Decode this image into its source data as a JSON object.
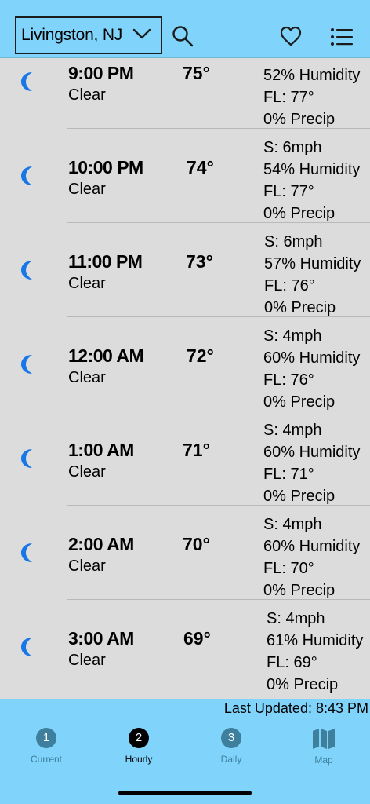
{
  "header": {
    "location": "Livingston, NJ",
    "icons": [
      "chevron-down-icon",
      "search-icon",
      "heart-icon",
      "list-icon"
    ]
  },
  "hourly": [
    {
      "time": "9:00 PM",
      "condition": "Clear",
      "temp": "75°",
      "wind": "",
      "humidity": "52% Humidity",
      "feels_like": "FL: 77°",
      "precip": "0% Precip",
      "icon": "moon-icon"
    },
    {
      "time": "10:00 PM",
      "condition": "Clear",
      "temp": "74°",
      "wind": "S: 6mph",
      "humidity": "54% Humidity",
      "feels_like": "FL: 77°",
      "precip": "0% Precip",
      "icon": "moon-icon"
    },
    {
      "time": "11:00 PM",
      "condition": "Clear",
      "temp": "73°",
      "wind": "S: 6mph",
      "humidity": "57% Humidity",
      "feels_like": "FL: 76°",
      "precip": "0% Precip",
      "icon": "moon-icon"
    },
    {
      "time": "12:00 AM",
      "condition": "Clear",
      "temp": "72°",
      "wind": "S: 4mph",
      "humidity": "60% Humidity",
      "feels_like": "FL: 76°",
      "precip": "0% Precip",
      "icon": "moon-icon"
    },
    {
      "time": "1:00 AM",
      "condition": "Clear",
      "temp": "71°",
      "wind": "S: 4mph",
      "humidity": "60% Humidity",
      "feels_like": "FL: 71°",
      "precip": "0% Precip",
      "icon": "moon-icon"
    },
    {
      "time": "2:00 AM",
      "condition": "Clear",
      "temp": "70°",
      "wind": "S: 4mph",
      "humidity": "60% Humidity",
      "feels_like": "FL: 70°",
      "precip": "0% Precip",
      "icon": "moon-icon"
    },
    {
      "time": "3:00 AM",
      "condition": "Clear",
      "temp": "69°",
      "wind": "S: 4mph",
      "humidity": "61% Humidity",
      "feels_like": "FL: 69°",
      "precip": "0% Precip",
      "icon": "moon-icon"
    }
  ],
  "footer": {
    "last_updated": "Last Updated: 8:43 PM",
    "tabs": [
      {
        "number": "1",
        "label": "Current",
        "active": false
      },
      {
        "number": "2",
        "label": "Hourly",
        "active": true
      },
      {
        "number": "3",
        "label": "Daily",
        "active": false
      },
      {
        "number": "",
        "label": "Map",
        "active": false,
        "icon": "map-icon"
      }
    ]
  },
  "colors": {
    "header_bg": "#80d4fb",
    "list_bg": "#dcdcdc",
    "moon": "#1877e6",
    "tab_inactive": "#3d7f9c",
    "tab_active": "#000000"
  }
}
